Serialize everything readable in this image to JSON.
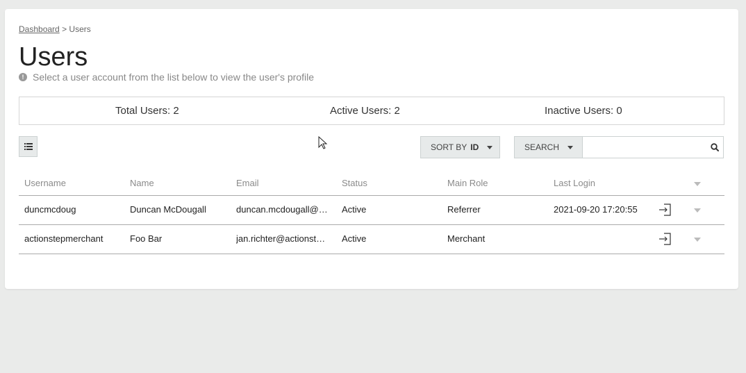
{
  "breadcrumb": {
    "link_label": "Dashboard",
    "separator": ">",
    "current": "Users"
  },
  "page": {
    "title": "Users",
    "hint": "Select a user account from the list below to view the user's profile"
  },
  "stats": {
    "total": "Total Users: 2",
    "active": "Active Users: 2",
    "inactive": "Inactive Users: 0"
  },
  "toolbar": {
    "list_view_icon": "list-icon",
    "sort_label": "SORT BY",
    "sort_value": "ID",
    "search_label": "SEARCH",
    "search_value": "",
    "search_placeholder": ""
  },
  "table": {
    "columns": [
      "Username",
      "Name",
      "Email",
      "Status",
      "Main Role",
      "Last Login"
    ],
    "rows": [
      {
        "username": "duncmcdoug",
        "name": "Duncan McDougall",
        "email": "duncan.mcdougall@a...",
        "status": "Active",
        "role": "Referrer",
        "last_login": "2021-09-20 17:20:55"
      },
      {
        "username": "actionstepmerchant",
        "name": "Foo Bar",
        "email": "jan.richter@actionste...",
        "status": "Active",
        "role": "Merchant",
        "last_login": ""
      }
    ]
  },
  "colors": {
    "background": "#eaebea",
    "card": "#ffffff",
    "button_bg": "#e7eaea"
  }
}
